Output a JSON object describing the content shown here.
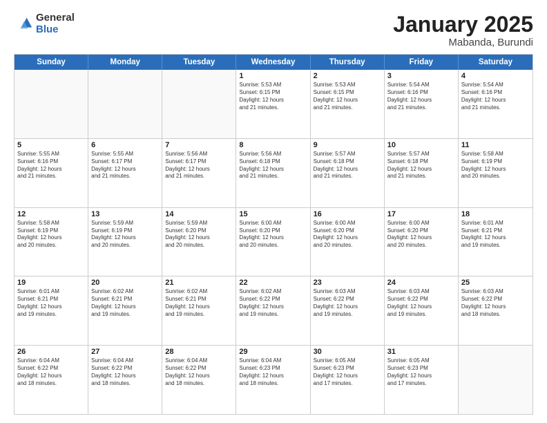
{
  "header": {
    "logo_general": "General",
    "logo_blue": "Blue",
    "title": "January 2025",
    "subtitle": "Mabanda, Burundi"
  },
  "days_of_week": [
    "Sunday",
    "Monday",
    "Tuesday",
    "Wednesday",
    "Thursday",
    "Friday",
    "Saturday"
  ],
  "weeks": [
    [
      {
        "day": "",
        "info": ""
      },
      {
        "day": "",
        "info": ""
      },
      {
        "day": "",
        "info": ""
      },
      {
        "day": "1",
        "info": "Sunrise: 5:53 AM\nSunset: 6:15 PM\nDaylight: 12 hours\nand 21 minutes."
      },
      {
        "day": "2",
        "info": "Sunrise: 5:53 AM\nSunset: 6:15 PM\nDaylight: 12 hours\nand 21 minutes."
      },
      {
        "day": "3",
        "info": "Sunrise: 5:54 AM\nSunset: 6:16 PM\nDaylight: 12 hours\nand 21 minutes."
      },
      {
        "day": "4",
        "info": "Sunrise: 5:54 AM\nSunset: 6:16 PM\nDaylight: 12 hours\nand 21 minutes."
      }
    ],
    [
      {
        "day": "5",
        "info": "Sunrise: 5:55 AM\nSunset: 6:16 PM\nDaylight: 12 hours\nand 21 minutes."
      },
      {
        "day": "6",
        "info": "Sunrise: 5:55 AM\nSunset: 6:17 PM\nDaylight: 12 hours\nand 21 minutes."
      },
      {
        "day": "7",
        "info": "Sunrise: 5:56 AM\nSunset: 6:17 PM\nDaylight: 12 hours\nand 21 minutes."
      },
      {
        "day": "8",
        "info": "Sunrise: 5:56 AM\nSunset: 6:18 PM\nDaylight: 12 hours\nand 21 minutes."
      },
      {
        "day": "9",
        "info": "Sunrise: 5:57 AM\nSunset: 6:18 PM\nDaylight: 12 hours\nand 21 minutes."
      },
      {
        "day": "10",
        "info": "Sunrise: 5:57 AM\nSunset: 6:18 PM\nDaylight: 12 hours\nand 21 minutes."
      },
      {
        "day": "11",
        "info": "Sunrise: 5:58 AM\nSunset: 6:19 PM\nDaylight: 12 hours\nand 20 minutes."
      }
    ],
    [
      {
        "day": "12",
        "info": "Sunrise: 5:58 AM\nSunset: 6:19 PM\nDaylight: 12 hours\nand 20 minutes."
      },
      {
        "day": "13",
        "info": "Sunrise: 5:59 AM\nSunset: 6:19 PM\nDaylight: 12 hours\nand 20 minutes."
      },
      {
        "day": "14",
        "info": "Sunrise: 5:59 AM\nSunset: 6:20 PM\nDaylight: 12 hours\nand 20 minutes."
      },
      {
        "day": "15",
        "info": "Sunrise: 6:00 AM\nSunset: 6:20 PM\nDaylight: 12 hours\nand 20 minutes."
      },
      {
        "day": "16",
        "info": "Sunrise: 6:00 AM\nSunset: 6:20 PM\nDaylight: 12 hours\nand 20 minutes."
      },
      {
        "day": "17",
        "info": "Sunrise: 6:00 AM\nSunset: 6:20 PM\nDaylight: 12 hours\nand 20 minutes."
      },
      {
        "day": "18",
        "info": "Sunrise: 6:01 AM\nSunset: 6:21 PM\nDaylight: 12 hours\nand 19 minutes."
      }
    ],
    [
      {
        "day": "19",
        "info": "Sunrise: 6:01 AM\nSunset: 6:21 PM\nDaylight: 12 hours\nand 19 minutes."
      },
      {
        "day": "20",
        "info": "Sunrise: 6:02 AM\nSunset: 6:21 PM\nDaylight: 12 hours\nand 19 minutes."
      },
      {
        "day": "21",
        "info": "Sunrise: 6:02 AM\nSunset: 6:21 PM\nDaylight: 12 hours\nand 19 minutes."
      },
      {
        "day": "22",
        "info": "Sunrise: 6:02 AM\nSunset: 6:22 PM\nDaylight: 12 hours\nand 19 minutes."
      },
      {
        "day": "23",
        "info": "Sunrise: 6:03 AM\nSunset: 6:22 PM\nDaylight: 12 hours\nand 19 minutes."
      },
      {
        "day": "24",
        "info": "Sunrise: 6:03 AM\nSunset: 6:22 PM\nDaylight: 12 hours\nand 19 minutes."
      },
      {
        "day": "25",
        "info": "Sunrise: 6:03 AM\nSunset: 6:22 PM\nDaylight: 12 hours\nand 18 minutes."
      }
    ],
    [
      {
        "day": "26",
        "info": "Sunrise: 6:04 AM\nSunset: 6:22 PM\nDaylight: 12 hours\nand 18 minutes."
      },
      {
        "day": "27",
        "info": "Sunrise: 6:04 AM\nSunset: 6:22 PM\nDaylight: 12 hours\nand 18 minutes."
      },
      {
        "day": "28",
        "info": "Sunrise: 6:04 AM\nSunset: 6:22 PM\nDaylight: 12 hours\nand 18 minutes."
      },
      {
        "day": "29",
        "info": "Sunrise: 6:04 AM\nSunset: 6:23 PM\nDaylight: 12 hours\nand 18 minutes."
      },
      {
        "day": "30",
        "info": "Sunrise: 6:05 AM\nSunset: 6:23 PM\nDaylight: 12 hours\nand 17 minutes."
      },
      {
        "day": "31",
        "info": "Sunrise: 6:05 AM\nSunset: 6:23 PM\nDaylight: 12 hours\nand 17 minutes."
      },
      {
        "day": "",
        "info": ""
      }
    ]
  ]
}
